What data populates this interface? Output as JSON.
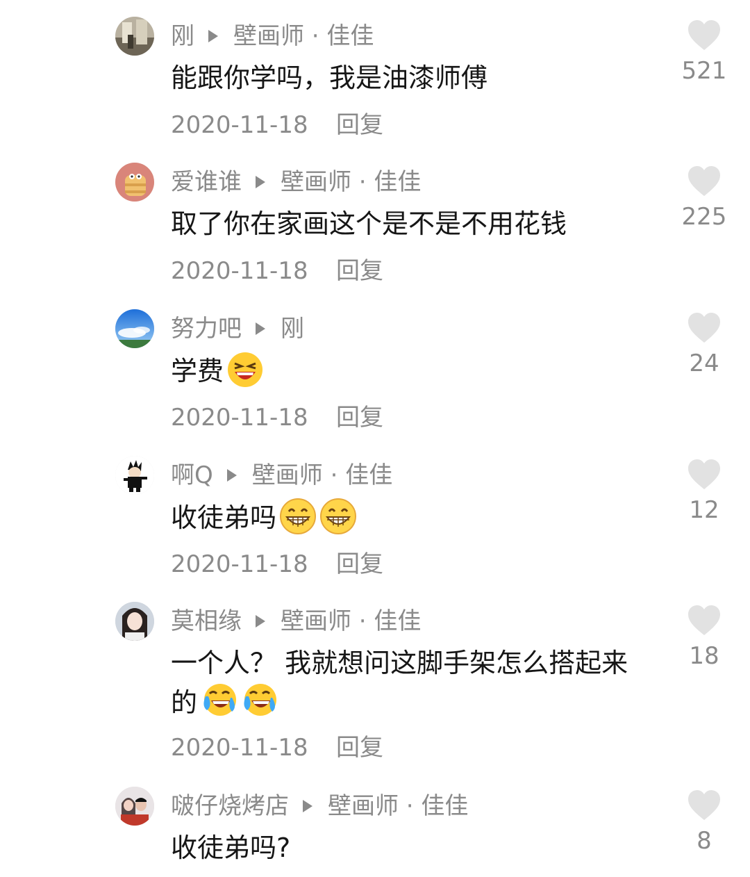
{
  "colors": {
    "meta": "#8a8a8a",
    "text": "#161616",
    "heart": "#e2e2e2"
  },
  "comments": [
    {
      "user": "刚",
      "reply_to": "壁画师 · 佳佳",
      "text": "能跟你学吗，我是油漆师傅",
      "emojis": [],
      "date": "2020-11-18",
      "reply_label": "回复",
      "likes": "521",
      "avatar": "photo-avatar"
    },
    {
      "user": "爱谁谁",
      "reply_to": "壁画师 · 佳佳",
      "text": "取了你在家画这个是不是不用花钱",
      "emojis": [],
      "date": "2020-11-18",
      "reply_label": "回复",
      "likes": "225",
      "avatar": "cartoon-avatar"
    },
    {
      "user": "努力吧",
      "reply_to": "刚",
      "text": "学费",
      "emojis": [
        "laughing-emoji"
      ],
      "date": "2020-11-18",
      "reply_label": "回复",
      "likes": "24",
      "avatar": "sky-avatar"
    },
    {
      "user": "啊Q",
      "reply_to": "壁画师 · 佳佳",
      "text": "收徒弟吗",
      "emojis": [
        "grin-emoji",
        "grin-emoji"
      ],
      "date": "2020-11-18",
      "reply_label": "回复",
      "likes": "12",
      "avatar": "character-avatar"
    },
    {
      "user": "莫相缘",
      "reply_to": "壁画师 · 佳佳",
      "text": "一个人？ 我就想问这脚手架怎么搭起来的",
      "emojis": [
        "tears-of-joy-emoji",
        "tears-of-joy-emoji"
      ],
      "date": "2020-11-18",
      "reply_label": "回复",
      "likes": "18",
      "avatar": "portrait-avatar"
    },
    {
      "user": "啵仔烧烤店",
      "reply_to": "壁画师 · 佳佳",
      "text": "收徒弟吗?",
      "emojis": [],
      "date": "",
      "reply_label": "",
      "likes": "8",
      "avatar": "couple-avatar"
    }
  ]
}
